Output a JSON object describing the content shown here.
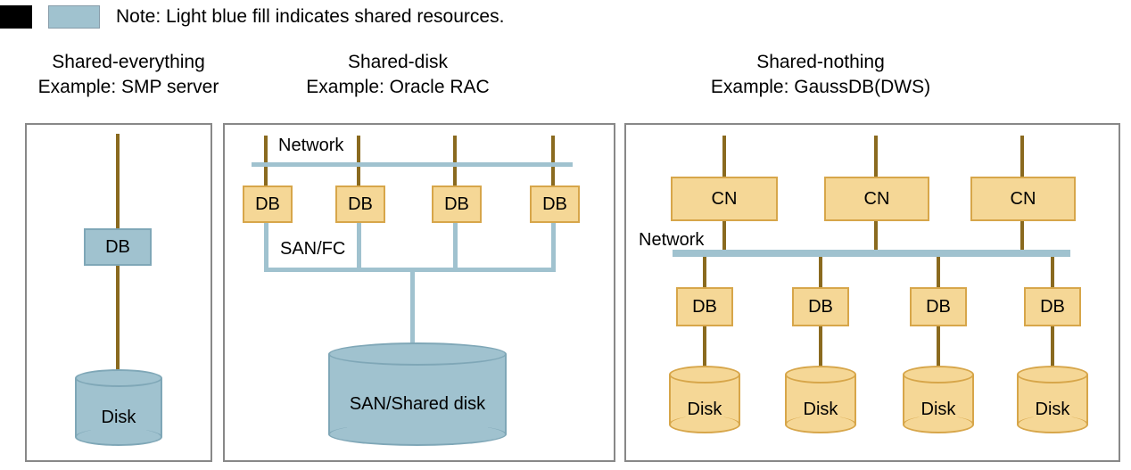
{
  "legend": {
    "note": "Note: Light blue fill indicates shared resources."
  },
  "col1": {
    "title1": "Shared-everything",
    "title2": "Example: SMP server",
    "db": "DB",
    "disk": "Disk"
  },
  "col2": {
    "title1": "Shared-disk",
    "title2": "Example: Oracle RAC",
    "network": "Network",
    "db1": "DB",
    "db2": "DB",
    "db3": "DB",
    "db4": "DB",
    "sanfc": "SAN/FC",
    "sandisk": "SAN/Shared disk"
  },
  "col3": {
    "title1": "Shared-nothing",
    "title2": "Example: GaussDB(DWS)",
    "cn1": "CN",
    "cn2": "CN",
    "cn3": "CN",
    "network": "Network",
    "db1": "DB",
    "db2": "DB",
    "db3": "DB",
    "db4": "DB",
    "disk1": "Disk",
    "disk2": "Disk",
    "disk3": "Disk",
    "disk4": "Disk"
  }
}
